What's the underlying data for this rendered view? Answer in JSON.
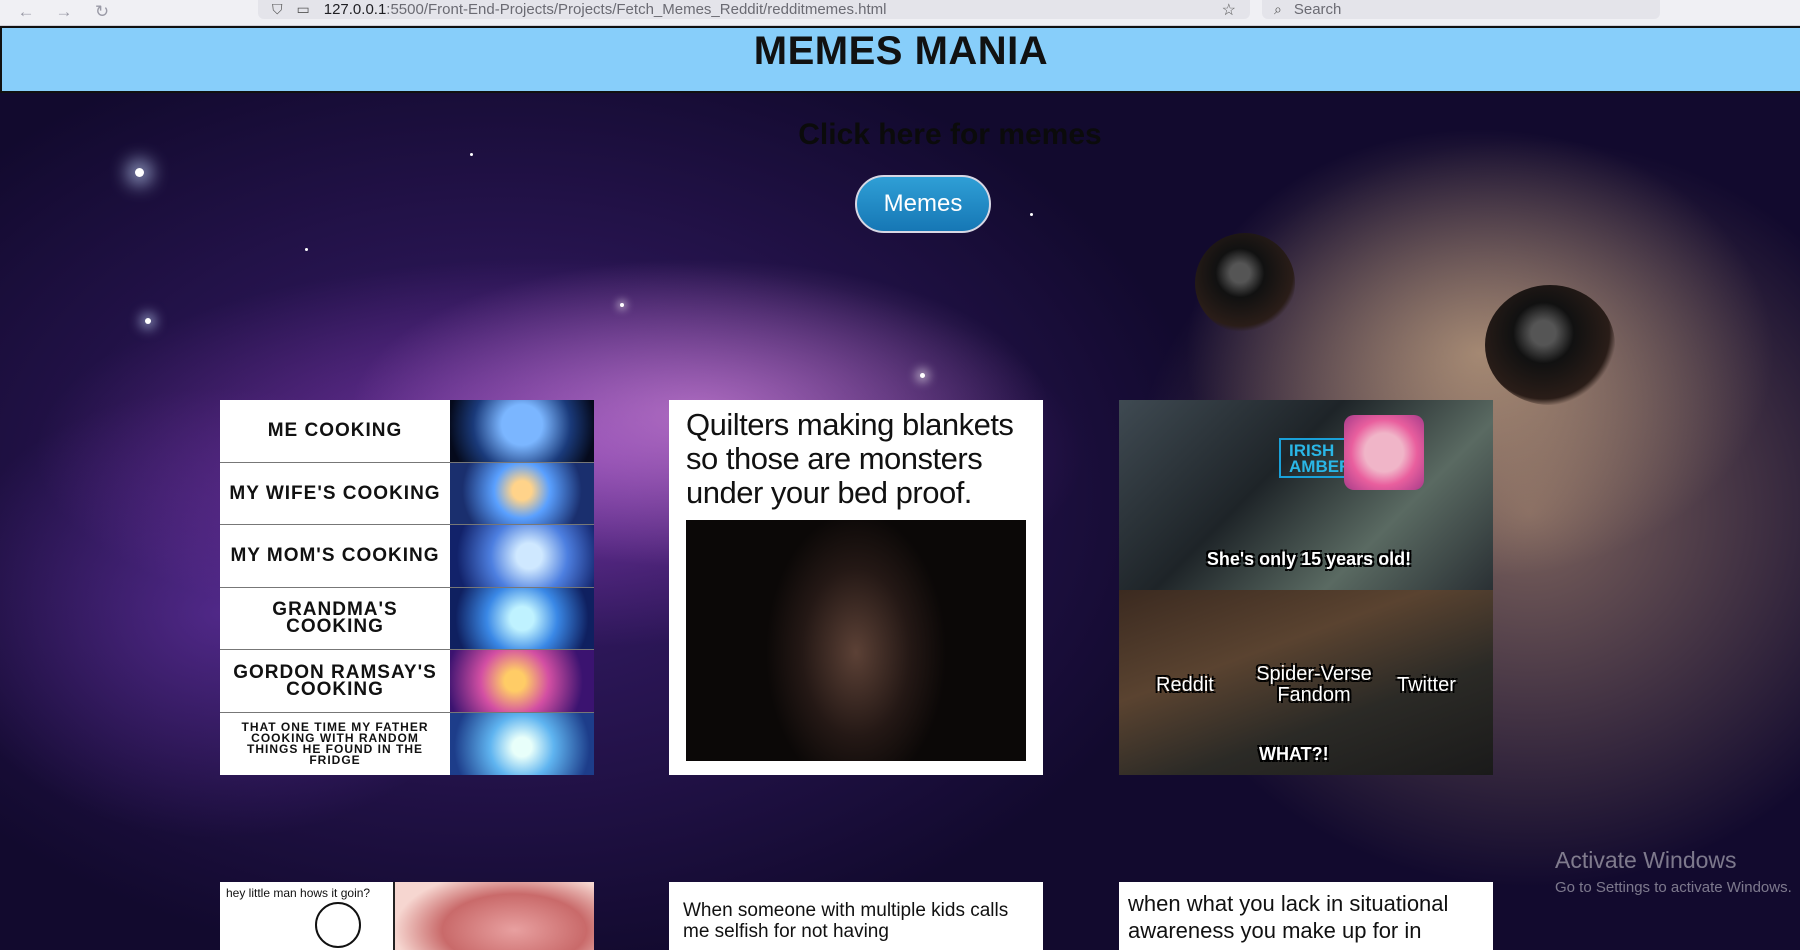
{
  "browser": {
    "url_host": "127.0.0.1",
    "url_rest": ":5500/Front-End-Projects/Projects/Fetch_Memes_Reddit/redditmemes.html",
    "search_placeholder": "Search",
    "back_icon": "←",
    "forward_icon": "→",
    "reload_icon": "↻"
  },
  "header": {
    "title": "MEMES MANIA"
  },
  "cta": {
    "text": "Click here for memes",
    "button_label": "Memes"
  },
  "memes": {
    "galaxy_brain": [
      "ME COOKING",
      "MY WIFE'S COOKING",
      "MY MOM'S COOKING",
      "GRANDMA'S COOKING",
      "GORDON RAMSAY'S COOKING",
      "THAT ONE TIME MY FATHER COOKING WITH RANDOM THINGS HE FOUND IN THE FRIDGE"
    ],
    "quilters": {
      "text": "Quilters making blankets so those are monsters under your bed proof."
    },
    "sunny": {
      "sign": "IRISH AMBER",
      "top_caption": "She's only 15 years old!",
      "left": "Reddit",
      "middle": "Spider-Verse Fandom",
      "right": "Twitter",
      "bottom": "WHAT?!"
    },
    "rage": {
      "text": "hey little man hows it goin?"
    },
    "selfish": {
      "text": "When someone with multiple kids calls me selfish for not having"
    },
    "awareness": {
      "text": "when what you lack in situational awareness you make up for in"
    }
  },
  "watermark": {
    "line1": "Activate Windows",
    "line2": "Go to Settings to activate Windows."
  }
}
